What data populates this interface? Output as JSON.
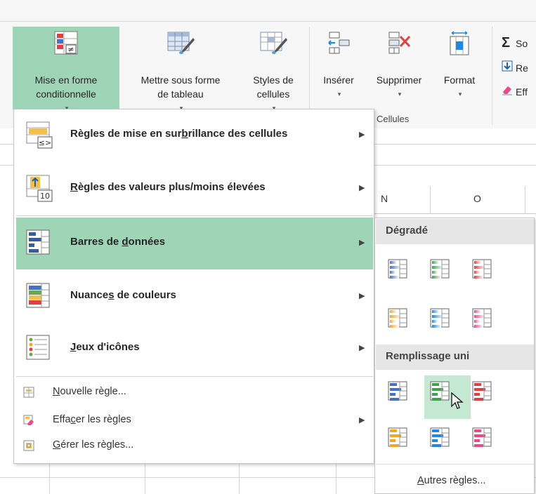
{
  "ribbon": {
    "conditional_formatting": {
      "line1": "Mise en forme",
      "line2": "conditionnelle",
      "caret": "▾"
    },
    "format_as_table": {
      "line1": "Mettre sous forme",
      "line2": "de tableau",
      "caret": "▾"
    },
    "cell_styles": {
      "line1": "Styles de",
      "line2": "cellules",
      "caret": "▾"
    },
    "insert": {
      "line1": "Insérer",
      "caret": "▾"
    },
    "delete": {
      "line1": "Supprimer",
      "caret": "▾"
    },
    "format": {
      "line1": "Format",
      "caret": "▾"
    },
    "cells_group_label": "Cellules",
    "editing": {
      "sum_glyph": "Σ",
      "sum_label": "So",
      "fill_label": "Re",
      "clear_label": "Eff"
    }
  },
  "sheet": {
    "columns": [
      "N",
      "O"
    ]
  },
  "menu": {
    "highlight_rules": {
      "pre": "Règles de mise en sur",
      "ul": "b",
      "post": "rillance des cellules"
    },
    "top_bottom_rules": {
      "pre": "",
      "ul": "R",
      "post": "ègles des valeurs plus/moins élevées"
    },
    "data_bars": {
      "pre": "Barres de ",
      "ul": "d",
      "post": "onnées"
    },
    "color_scales": {
      "pre": "Nuance",
      "ul": "s",
      "post": " de couleurs"
    },
    "icon_sets": {
      "pre": "",
      "ul": "J",
      "post": "eux d'icônes"
    },
    "new_rule": {
      "pre": "",
      "ul": "N",
      "post": "ouvelle règle..."
    },
    "clear_rules": {
      "pre": "Effa",
      "ul": "c",
      "post": "er les règles"
    },
    "manage_rules": {
      "pre": "",
      "ul": "G",
      "post": "érer les règles..."
    },
    "arrow": "▶"
  },
  "submenu": {
    "gradient_header": "Dégradé",
    "solid_header": "Remplissage uni",
    "more_rules": {
      "pre": "",
      "ul": "A",
      "post": "utres règles..."
    },
    "gradient_colors": [
      "#4472c4",
      "#3fa34d",
      "#e0403f",
      "#f5a623",
      "#1e88e5",
      "#e84a8a"
    ],
    "solid_colors": [
      "#4472c4",
      "#3fa34d",
      "#e0403f",
      "#f5a623",
      "#1e88e5",
      "#e84a8a"
    ]
  },
  "icons": {
    "conditional_formatting": "conditional-formatting-icon",
    "cursor": "mouse-pointer-icon"
  }
}
